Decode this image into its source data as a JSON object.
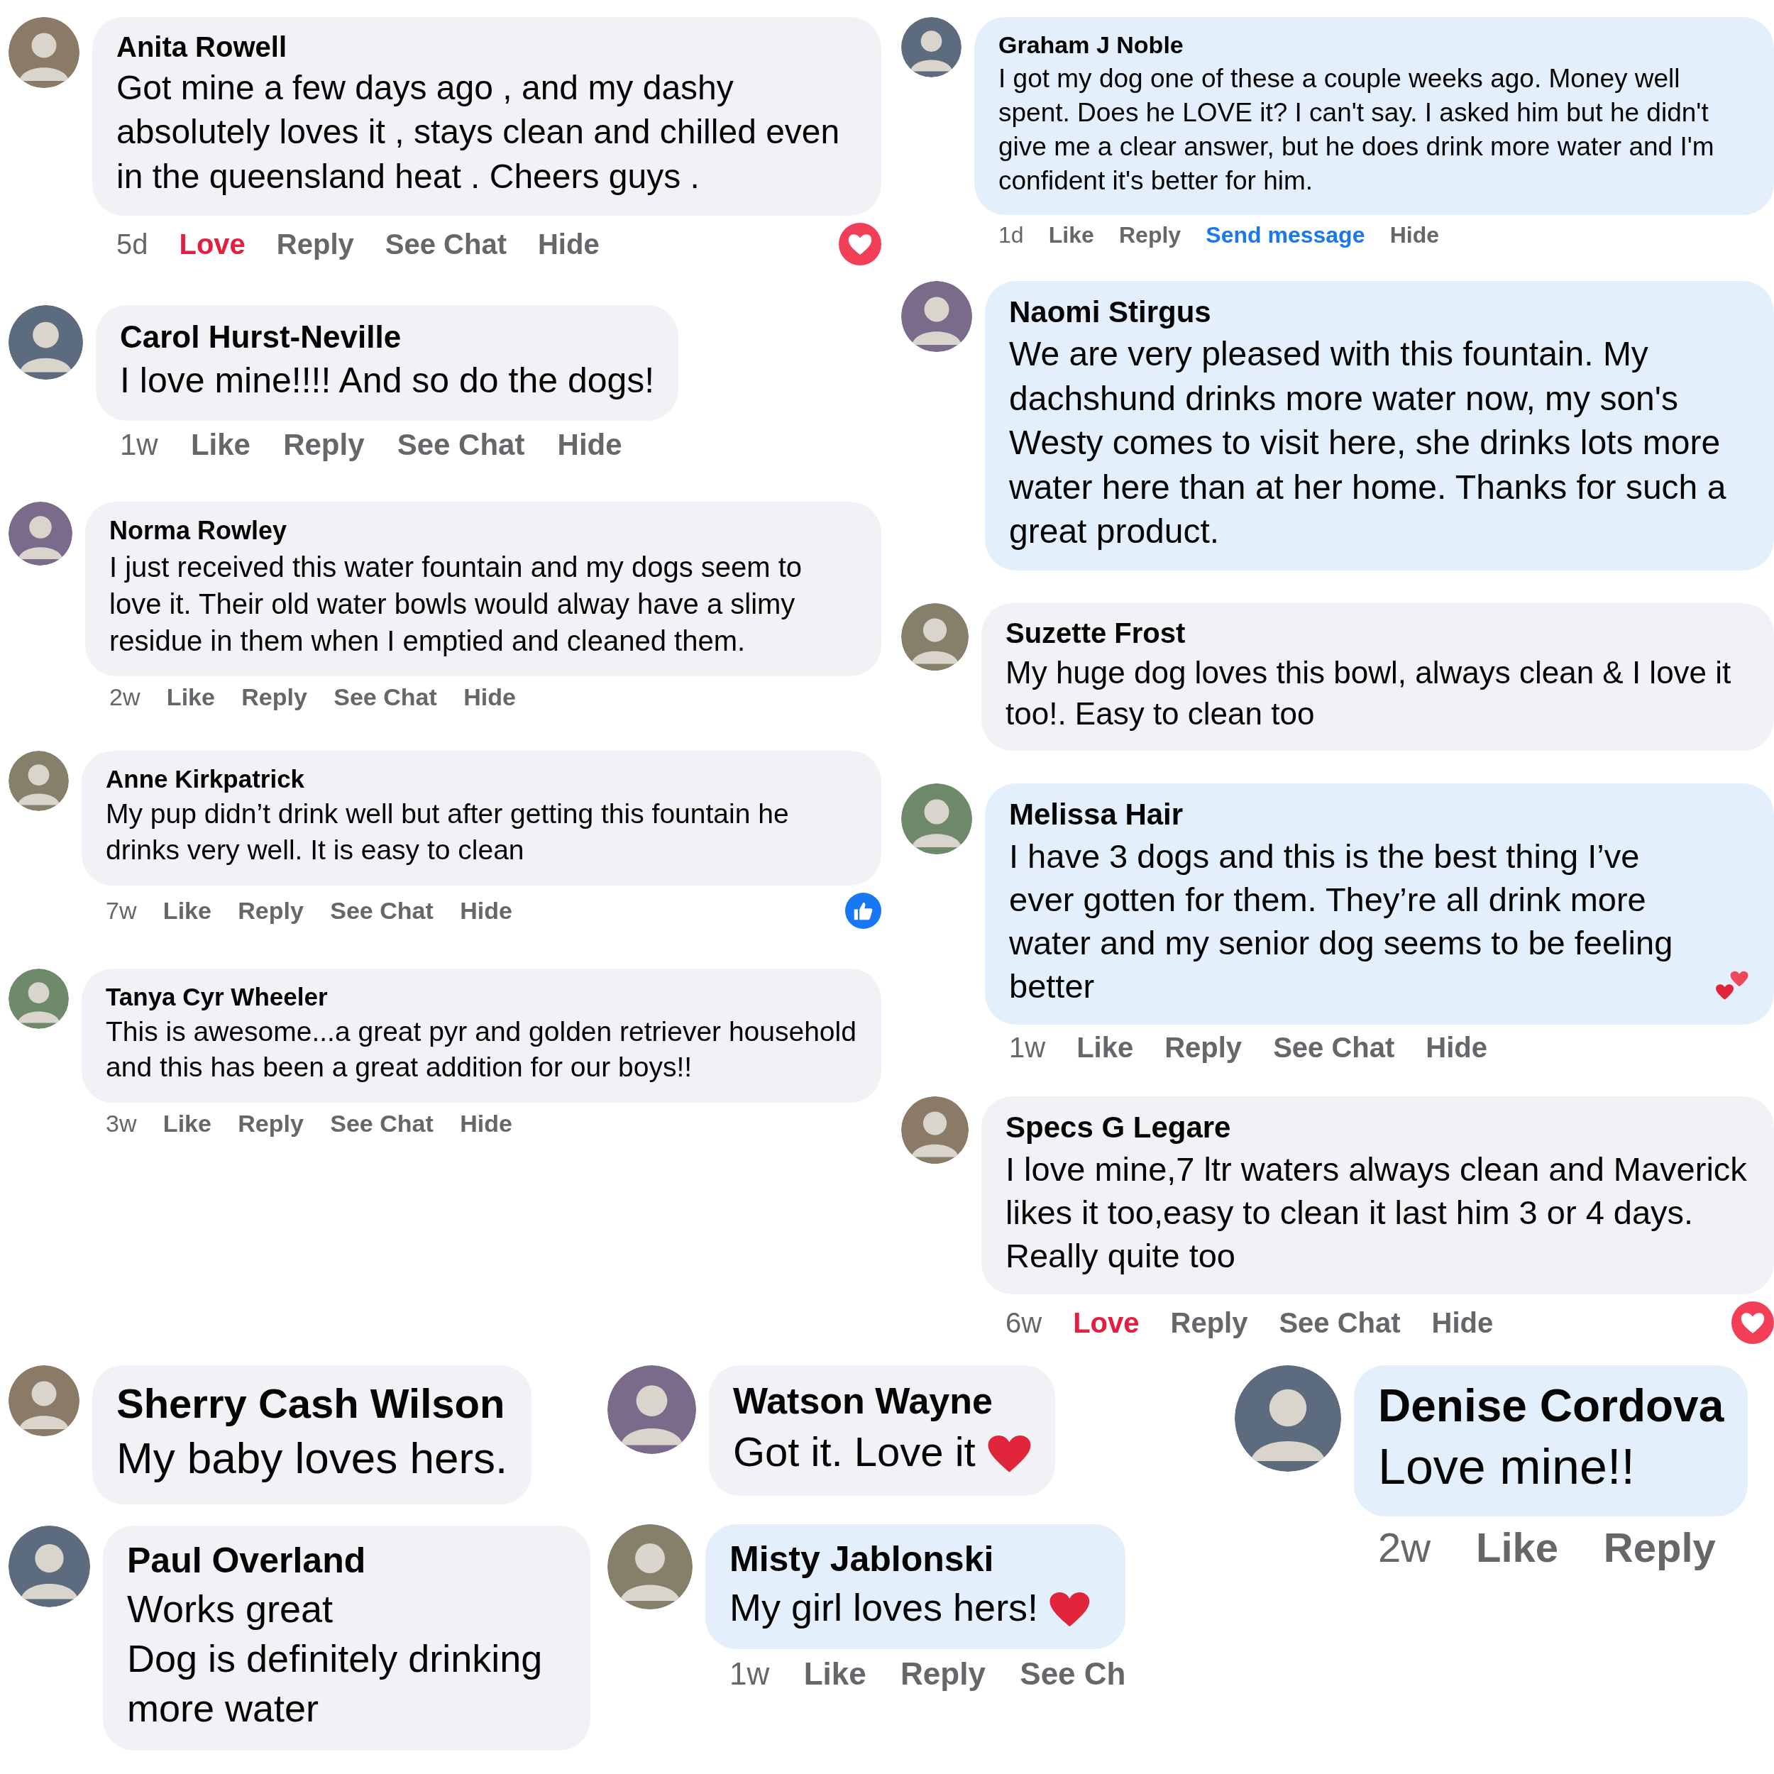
{
  "left_column": [
    {
      "name": "Anita Rowell",
      "text": "Got mine a few days ago , and my dashy absolutely loves it , stays clean and chilled even in the queensland heat . Cheers guys .",
      "color": "#f0f2f5",
      "badge": {
        "kind": "love"
      },
      "actions": [
        {
          "kind": "time",
          "label": "5d"
        },
        {
          "kind": "reaction",
          "label": "Love",
          "selected": true
        },
        {
          "kind": "action",
          "label": "Reply"
        },
        {
          "kind": "action",
          "label": "See Chat"
        },
        {
          "kind": "action",
          "label": "Hide"
        }
      ]
    },
    {
      "name": "Carol Hurst-Neville",
      "text": "I love mine!!!! And so do the dogs!",
      "color": "#f0f2f5",
      "actions": [
        {
          "kind": "time",
          "label": "1w"
        },
        {
          "kind": "reaction",
          "label": "Like",
          "selected": false
        },
        {
          "kind": "action",
          "label": "Reply"
        },
        {
          "kind": "action",
          "label": "See Chat"
        },
        {
          "kind": "action",
          "label": "Hide"
        }
      ]
    },
    {
      "name": "Norma Rowley",
      "text": "I just received this water fountain and my dogs seem to love it. Their old water bowls would alway have a slimy residue in them when I emptied and cleaned them.",
      "color": "#f0f2f5",
      "actions": [
        {
          "kind": "time",
          "label": "2w"
        },
        {
          "kind": "reaction",
          "label": "Like",
          "selected": false
        },
        {
          "kind": "action",
          "label": "Reply"
        },
        {
          "kind": "action",
          "label": "See Chat"
        },
        {
          "kind": "action",
          "label": "Hide"
        }
      ]
    },
    {
      "name": "Anne Kirkpatrick",
      "text": "My pup didn’t drink well but after getting this fountain he drinks very well. It is easy to clean",
      "color": "#f0f2f5",
      "badge": {
        "kind": "like"
      },
      "actions": [
        {
          "kind": "time",
          "label": "7w"
        },
        {
          "kind": "reaction",
          "label": "Like",
          "selected": false
        },
        {
          "kind": "action",
          "label": "Reply"
        },
        {
          "kind": "action",
          "label": "See Chat"
        },
        {
          "kind": "action",
          "label": "Hide"
        }
      ]
    },
    {
      "name": "Tanya Cyr Wheeler",
      "text": "This is awesome...a great pyr and golden retriever household and this has been a great addition for our boys!!",
      "color": "#f0f2f5",
      "actions": [
        {
          "kind": "time",
          "label": "3w"
        },
        {
          "kind": "reaction",
          "label": "Like",
          "selected": false
        },
        {
          "kind": "action",
          "label": "Reply"
        },
        {
          "kind": "action",
          "label": "See Chat"
        },
        {
          "kind": "action",
          "label": "Hide"
        }
      ]
    }
  ],
  "right_column": [
    {
      "name": "Graham J Noble",
      "text": "I got my dog one of these a couple weeks ago. Money well spent. Does he LOVE it? I can't say. I asked him but he didn't give me a clear answer, but he does drink more water and I'm confident it's better for him.",
      "color": "#e4effc",
      "actions": [
        {
          "kind": "time",
          "label": "1d"
        },
        {
          "kind": "reaction",
          "label": "Like",
          "selected": false
        },
        {
          "kind": "action",
          "label": "Reply"
        },
        {
          "kind": "link",
          "label": "Send message"
        },
        {
          "kind": "action",
          "label": "Hide"
        }
      ]
    },
    {
      "name": "Naomi Stirgus",
      "text": "We are very pleased with this fountain. My dachshund drinks more water now, my son's Westy comes to visit here, she drinks lots more water here than at her home. Thanks for such a great product.",
      "color": "#e4effc"
    },
    {
      "name": "Suzette Frost",
      "text": "My huge dog loves this bowl, always clean & I love it too!. Easy to clean too",
      "color": "#f0f2f5"
    },
    {
      "name": "Melissa Hair",
      "text": "I have 3 dogs and this is the best thing I’ve ever gotten for them. They’re all drink more water and my senior dog seems to be feeling better",
      "color": "#e4effc",
      "emoji": {
        "kind": "hearts"
      },
      "actions": [
        {
          "kind": "time",
          "label": "1w"
        },
        {
          "kind": "reaction",
          "label": "Like",
          "selected": false
        },
        {
          "kind": "action",
          "label": "Reply"
        },
        {
          "kind": "action",
          "label": "See Chat"
        },
        {
          "kind": "action",
          "label": "Hide"
        }
      ]
    },
    {
      "name": "Specs G Legare",
      "text": "I love mine,7 ltr waters always clean and Maverick likes it too,easy to clean it last him 3 or 4 days. Really quite too",
      "color": "#f0f2f5",
      "badge": {
        "kind": "love"
      },
      "actions": [
        {
          "kind": "time",
          "label": "6w"
        },
        {
          "kind": "reaction",
          "label": "Love",
          "selected": true
        },
        {
          "kind": "action",
          "label": "Reply"
        },
        {
          "kind": "action",
          "label": "See Chat"
        },
        {
          "kind": "action",
          "label": "Hide"
        }
      ]
    }
  ],
  "bottom_left": [
    {
      "name": "Sherry Cash Wilson",
      "text": "My baby loves hers.",
      "color": "#f0f2f5"
    },
    {
      "name": "Paul Overland",
      "text": "Works great\nDog is definitely drinking more water",
      "color": "#f0f2f5"
    }
  ],
  "bottom_middle": [
    {
      "name": "Watson Wayne",
      "text": "Got it. Love it",
      "color": "#f0f2f5",
      "emoji": {
        "kind": "heart"
      }
    },
    {
      "name": "Misty Jablonski",
      "text": "My girl loves hers!",
      "color": "#e4effc",
      "emoji": {
        "kind": "heart"
      },
      "actions": [
        {
          "kind": "time",
          "label": "1w"
        },
        {
          "kind": "reaction",
          "label": "Like",
          "selected": false
        },
        {
          "kind": "action",
          "label": "Reply"
        },
        {
          "kind": "action",
          "label": "See Ch"
        }
      ]
    }
  ],
  "bottom_right": [
    {
      "name": "Denise Cordova",
      "text": "Love mine!!",
      "color": "#e4effc",
      "actions": [
        {
          "kind": "time",
          "label": "2w"
        },
        {
          "kind": "reaction",
          "label": "Like",
          "selected": false
        },
        {
          "kind": "action",
          "label": "Reply"
        }
      ]
    }
  ]
}
